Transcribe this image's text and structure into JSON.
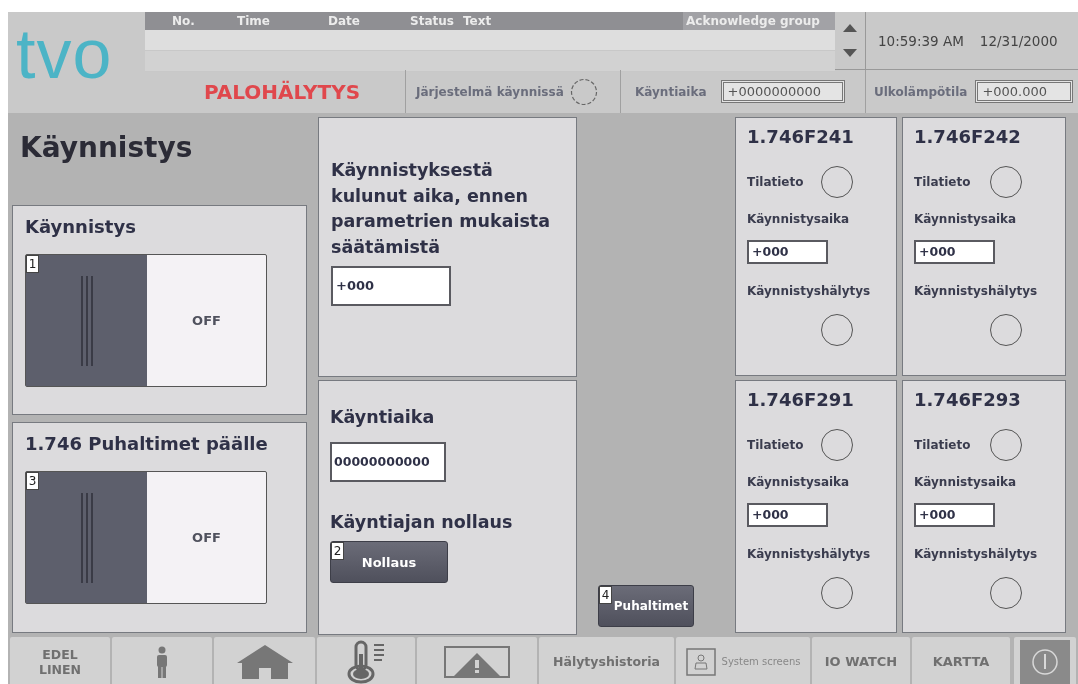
{
  "header": {
    "logo": "tvo",
    "alarm_table": {
      "columns": [
        "No.",
        "Time",
        "Date",
        "Status",
        "Text",
        "Acknowledge group"
      ]
    },
    "time": "10:59:39 AM",
    "date": "12/31/2000",
    "title": "PALOHÄLYTYS",
    "system_running_label": "Järjestelmä käynnissä",
    "runtime_label": "Käyntiaika",
    "runtime_value": "+0000000000",
    "outdoor_temp_label": "Ulkolämpötila",
    "outdoor_temp_value": "+000.000"
  },
  "page_title": "Käynnistys",
  "switches": [
    {
      "title": "Käynnistys",
      "badge": "1",
      "label": "OFF",
      "on": false
    },
    {
      "title": "1.746 Puhaltimet päälle",
      "badge": "3",
      "label": "OFF",
      "on": false
    }
  ],
  "elapsed": {
    "title": "Käynnistyksestä kulunut aika, ennen parametrien mukaista säätämistä",
    "value": "+000"
  },
  "runtime": {
    "title": "Käyntiaika",
    "value": "00000000000",
    "reset_title": "Käyntiajan nollaus",
    "reset_badge": "2",
    "reset_button": "Nollaus"
  },
  "fans_button": {
    "badge": "4",
    "label": "Puhaltimet"
  },
  "fans": [
    {
      "id": "1.746F241",
      "status_label": "Tilatieto",
      "start_time_label": "Käynnistysaika",
      "start_time_value": "+000",
      "start_alarm_label": "Käynnistyshälytys"
    },
    {
      "id": "1.746F242",
      "status_label": "Tilatieto",
      "start_time_label": "Käynnistysaika",
      "start_time_value": "+000",
      "start_alarm_label": "Käynnistyshälytys"
    },
    {
      "id": "1.746F291",
      "status_label": "Tilatieto",
      "start_time_label": "Käynnistysaika",
      "start_time_value": "+000",
      "start_alarm_label": "Käynnistyshälytys"
    },
    {
      "id": "1.746F293",
      "status_label": "Tilatieto",
      "start_time_label": "Käynnistysaika",
      "start_time_value": "+000",
      "start_alarm_label": "Käynnistyshälytys"
    }
  ],
  "nav": [
    {
      "kind": "text",
      "label": "EDEL LINEN"
    },
    {
      "kind": "person"
    },
    {
      "kind": "home"
    },
    {
      "kind": "thermometer"
    },
    {
      "kind": "alarm"
    },
    {
      "kind": "text",
      "label": "Hälytyshistoria"
    },
    {
      "kind": "system",
      "label": "System screens"
    },
    {
      "kind": "text",
      "label": "IO WATCH"
    },
    {
      "kind": "text",
      "label": "KARTTA"
    },
    {
      "kind": "power"
    }
  ]
}
